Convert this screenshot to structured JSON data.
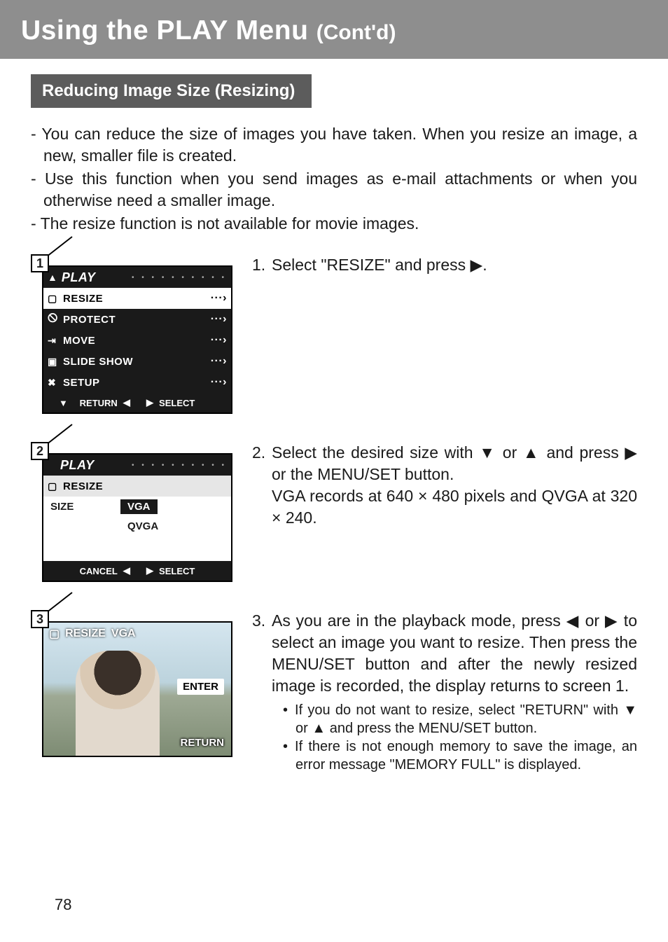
{
  "banner": {
    "title": "Using the PLAY Menu ",
    "sub": "(Cont'd)"
  },
  "section_heading": "Reducing Image Size (Resizing)",
  "intro": [
    "- You can reduce the size of images you have taken. When you resize an image, a new, smaller file is created.",
    "- Use this function when you send images as e-mail attachments or when you otherwise you need a smaller image.",
    "- The resize function is not available for movie images."
  ],
  "intro_fixed": [
    "- You can reduce the size of images you have taken. When you resize an image, a new, smaller file is created.",
    "- Use this function when you send images as e-mail attachments or when you otherwise need a smaller image.",
    "- The resize function is not available for movie images."
  ],
  "screen1": {
    "num": "1",
    "title": "PLAY",
    "items": [
      {
        "label": "RESIZE",
        "selected": true
      },
      {
        "label": "PROTECT",
        "selected": false
      },
      {
        "label": "MOVE",
        "selected": false
      },
      {
        "label": "SLIDE SHOW",
        "selected": false
      },
      {
        "label": "SETUP",
        "selected": false
      }
    ],
    "footer_left": "RETURN",
    "footer_right": "SELECT"
  },
  "screen2": {
    "num": "2",
    "title": "PLAY",
    "header_row": "RESIZE",
    "key": "SIZE",
    "options": [
      "VGA",
      "QVGA"
    ],
    "sel_index": 0,
    "footer_left": "CANCEL",
    "footer_right": "SELECT"
  },
  "screen3": {
    "num": "3",
    "top_left": "RESIZE",
    "top_right": "VGA",
    "enter": "ENTER",
    "return": "RETURN"
  },
  "step1": {
    "n": "1.",
    "text": "Select \"RESIZE\" and press ▶."
  },
  "step2": {
    "n": "2.",
    "line1": "Select the desired size with ▼ or ▲ and press ▶ or the MENU/SET button.",
    "line2": "VGA records at 640 × 480 pixels and QVGA at 320 × 240."
  },
  "step3": {
    "n": "3.",
    "body": "As you are in the playback mode, press ◀ or ▶ to select an image you want to resize. Then press the MENU/SET button and after the newly resized image is recorded, the display returns to screen 1.",
    "bullets": [
      "If you do not want to resize, select \"RETURN\" with ▼ or ▲ and press the MENU/SET button.",
      "If there is not enough memory to save the image, an error message \"MEMORY FULL\" is displayed."
    ]
  },
  "page_number": "78"
}
